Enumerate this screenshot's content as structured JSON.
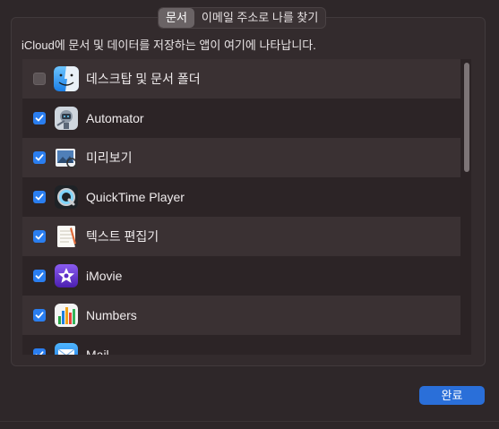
{
  "tabs": [
    {
      "label": "문서",
      "active": true
    },
    {
      "label": "이메일 주소로 나를 찾기",
      "active": false
    }
  ],
  "description": "iCloud에 문서 및 데이터를 저장하는 앱이 여기에 나타납니다.",
  "apps": [
    {
      "label": "데스크탑 및 문서 폴더",
      "checked": false,
      "icon": "finder-icon"
    },
    {
      "label": "Automator",
      "checked": true,
      "icon": "automator-icon"
    },
    {
      "label": "미리보기",
      "checked": true,
      "icon": "preview-icon"
    },
    {
      "label": "QuickTime Player",
      "checked": true,
      "icon": "quicktime-icon"
    },
    {
      "label": "텍스트 편집기",
      "checked": true,
      "icon": "textedit-icon"
    },
    {
      "label": "iMovie",
      "checked": true,
      "icon": "imovie-icon"
    },
    {
      "label": "Numbers",
      "checked": true,
      "icon": "numbers-icon"
    },
    {
      "label": "Mail",
      "checked": true,
      "icon": "mail-icon"
    }
  ],
  "done_label": "완료",
  "colors": {
    "accent": "#2a7ef0",
    "button": "#2a6fd9"
  }
}
